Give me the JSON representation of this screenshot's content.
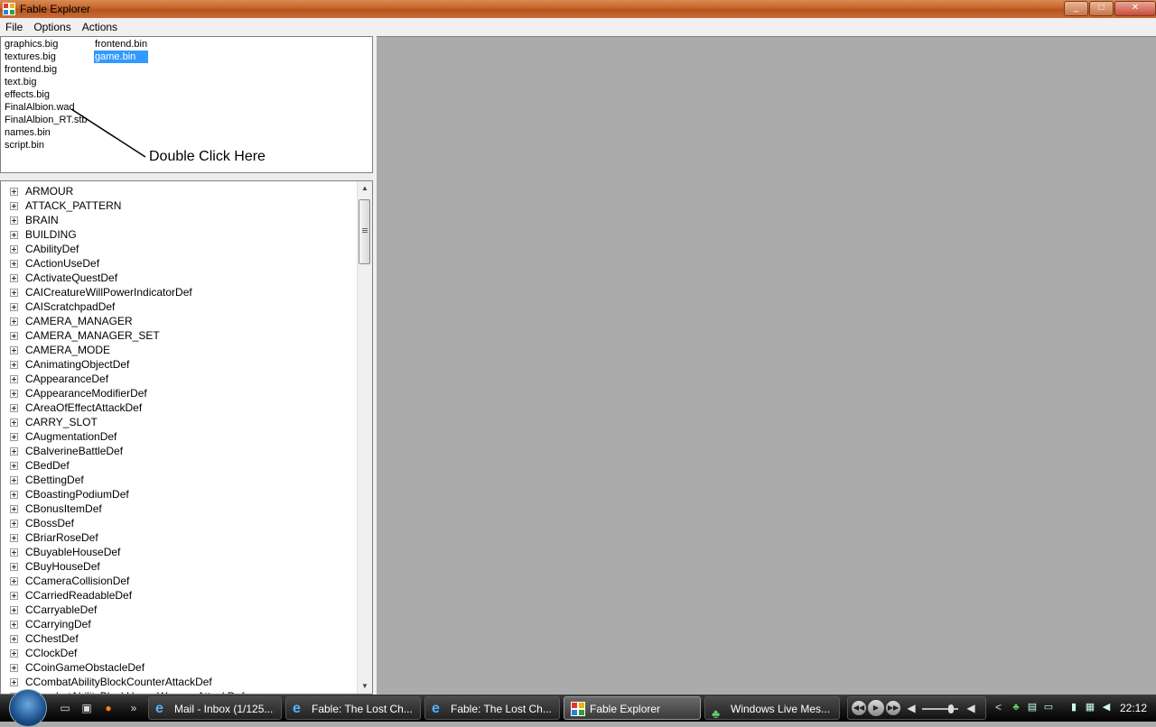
{
  "window": {
    "title": "Fable Explorer",
    "min": "_",
    "max": "□",
    "close": "✕"
  },
  "menu": [
    {
      "label": "File"
    },
    {
      "label": "Options"
    },
    {
      "label": "Actions"
    }
  ],
  "files": {
    "column1": [
      "graphics.big",
      "textures.big",
      "frontend.big",
      "text.big",
      "effects.big",
      "FinalAlbion.wad",
      "FinalAlbion_RT.stb",
      "names.bin",
      "script.bin"
    ],
    "column2": [
      "frontend.bin",
      "game.bin"
    ],
    "selected": "game.bin"
  },
  "annotation": {
    "text": "Double Click Here"
  },
  "tree": {
    "nodes": [
      "ARMOUR",
      "ATTACK_PATTERN",
      "BRAIN",
      "BUILDING",
      "CAbilityDef",
      "CActionUseDef",
      "CActivateQuestDef",
      "CAICreatureWillPowerIndicatorDef",
      "CAIScratchpadDef",
      "CAMERA_MANAGER",
      "CAMERA_MANAGER_SET",
      "CAMERA_MODE",
      "CAnimatingObjectDef",
      "CAppearanceDef",
      "CAppearanceModifierDef",
      "CAreaOfEffectAttackDef",
      "CARRY_SLOT",
      "CAugmentationDef",
      "CBalverineBattleDef",
      "CBedDef",
      "CBettingDef",
      "CBoastingPodiumDef",
      "CBonusItemDef",
      "CBossDef",
      "CBriarRoseDef",
      "CBuyableHouseDef",
      "CBuyHouseDef",
      "CCameraCollisionDef",
      "CCarriedReadableDef",
      "CCarryableDef",
      "CCarryingDef",
      "CChestDef",
      "CClockDef",
      "CCoinGameObstacleDef",
      "CCombatAbilityBlockCounterAttackDef",
      "CCombatAbilityBlockHeavyWeaponAttackDef"
    ],
    "scroll_up": "▲",
    "scroll_down": "▼"
  },
  "taskbar": {
    "quicklaunch_more": "»",
    "tasks": [
      {
        "label": "Mail - Inbox (1/125...",
        "icon": "ie-icon"
      },
      {
        "label": "Fable: The Lost Ch...",
        "icon": "ie-icon"
      },
      {
        "label": "Fable: The Lost Ch...",
        "icon": "ie-icon"
      },
      {
        "label": "Fable Explorer",
        "icon": "app-icon",
        "active": true
      },
      {
        "label": "Windows Live Mes...",
        "icon": "messenger-icon"
      }
    ],
    "media": {
      "prev": "◀◀",
      "play": "▶",
      "next": "▶▶",
      "volume_level": 0.8
    },
    "tray_chevron": "<",
    "clock": "22:12"
  }
}
